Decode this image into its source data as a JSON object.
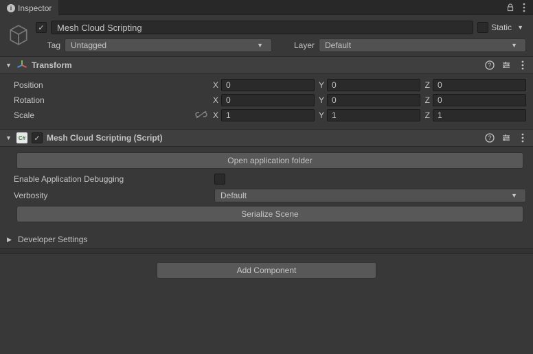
{
  "tab": {
    "label": "Inspector"
  },
  "header": {
    "enabled": true,
    "name": "Mesh Cloud Scripting",
    "static_label": "Static",
    "static_checked": false,
    "tag_label": "Tag",
    "tag_value": "Untagged",
    "layer_label": "Layer",
    "layer_value": "Default"
  },
  "transform": {
    "title": "Transform",
    "position": {
      "label": "Position",
      "x": "0",
      "y": "0",
      "z": "0"
    },
    "rotation": {
      "label": "Rotation",
      "x": "0",
      "y": "0",
      "z": "0"
    },
    "scale": {
      "label": "Scale",
      "x": "1",
      "y": "1",
      "z": "1"
    },
    "axis": {
      "x": "X",
      "y": "Y",
      "z": "Z"
    }
  },
  "script": {
    "title": "Mesh Cloud Scripting (Script)",
    "enabled": true,
    "open_folder": "Open application folder",
    "enable_debug_label": "Enable Application Debugging",
    "enable_debug_checked": false,
    "verbosity_label": "Verbosity",
    "verbosity_value": "Default",
    "serialize": "Serialize Scene"
  },
  "developer": {
    "label": "Developer Settings"
  },
  "add_component": "Add Component"
}
